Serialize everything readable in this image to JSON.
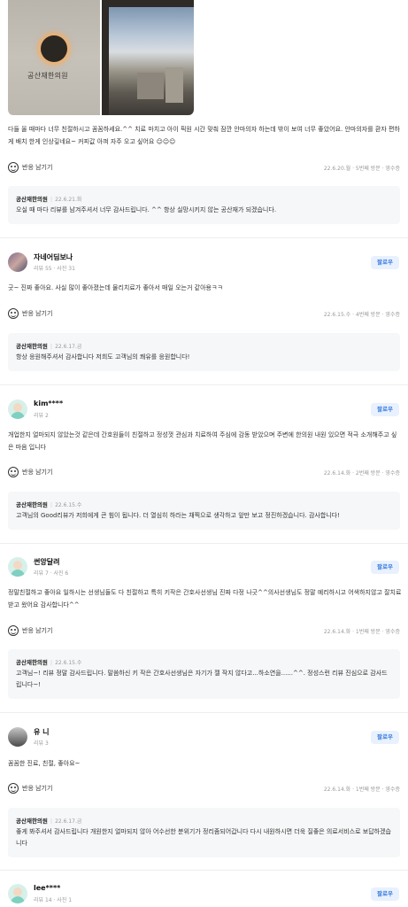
{
  "photos": {
    "sign_text": "공산재한의원"
  },
  "reviews": [
    {
      "body": "다들 올 때마다 너무 친절하시고 꼼꼼하세요.^^ 치료 마치고 아이 픽원 시간 맞춰 잠깐 안마의자 하는데 밖이 보여 너무 좋았어요. 안마의자를 환자 편하게 배치 한게 인상깊네요~ 커피값 아껴 자주 오고 싶어요 ☺☺☺",
      "react_label": "반응 남기기",
      "visit_info": "22.6.20.월 · 5번째 방문 · 영수증",
      "reply": {
        "name": "공산재한의원",
        "date": "22.6.21.화",
        "text": "오실 때 마다 리뷰를 남겨주셔서 너무 감사드립니다. ^^ 항상 실망시키지 않는 공산재가 되겠습니다."
      }
    },
    {
      "username": "자네어딤보나",
      "meta": "리뷰 55 · 사진 31",
      "follow_label": "팔로우",
      "body": "굿~ 진짜 좋아요. 사실 많이 좋아졌는데 물리치료가 좋아서 매일 오는거 같아용ㅋㅋ",
      "react_label": "반응 남기기",
      "visit_info": "22.6.15.수 · 4번째 방문 · 영수증",
      "reply": {
        "name": "공산재한의원",
        "date": "22.6.17.금",
        "text": "항상 응원해주셔서 감사합니다 저희도 고객님의 쾌유를 응원합니다!"
      }
    },
    {
      "username": "kim****",
      "meta": "리뷰 2",
      "follow_label": "팔로우",
      "body": "개업한지 얼마되지 않았는것 같은데 간호원들이 친절하고 정성껏 관심과 치료하여 주심에 감동 받았으며 주변에 한의원 내원 있으면 적극 소개해주고 싶은 마음 입니다",
      "react_label": "반응 남기기",
      "visit_info": "22.6.14.화 · 2번째 방문 · 영수증",
      "reply": {
        "name": "공산재한의원",
        "date": "22.6.15.수",
        "text": "고객님의 Good리뷰가 저희에게 큰 힘이 됩니다. 더 열심히 하라는 채찍으로 생각하고 앞만 보고 정진하겠습니다. 감사합니다!"
      }
    },
    {
      "username": "썬앙달려",
      "meta": "리뷰 7 · 사진 6",
      "follow_label": "팔로우",
      "body": "정말친절하고 좋아요 일하시는 선생님들도 다 친절하고 특히 키작은 간호사선생님 진짜 다정 나긋^^의사선생님도 정말 예리하시고 어색하지않고 잘치료받고 왔어요 감사합니다^^",
      "react_label": "반응 남기기",
      "visit_info": "22.6.14.화 · 1번째 방문 · 영수증",
      "reply": {
        "name": "공산재한의원",
        "date": "22.6.15.수",
        "text": "고객님~! 리뷰 정말 감사드립니다. 말씀하신 키 작은 간호사선생님은 자기가 젤 작지 않다고...하소연을......^^. 정성스런 리뷰 진심으로 감사드립니다~!"
      }
    },
    {
      "username": "유 니",
      "meta": "리뷰 3",
      "follow_label": "팔로우",
      "body": "꼼꼼한 진료, 친절, 좋아요~",
      "react_label": "반응 남기기",
      "visit_info": "22.6.14.화 · 1번째 방문 · 영수증",
      "reply": {
        "name": "공산재한의원",
        "date": "22.6.17.금",
        "text": "좋게 봐주셔서 감사드립니다 개원한지 얼마되지 않아 어수선한 분위기가 정리좀되어갑니다 다시 내원하시면 더욱 질좋은 의료서비스로 보답하겠습니다"
      }
    },
    {
      "username": "lee****",
      "meta": "리뷰 14 · 사진 1",
      "follow_label": "팔로우"
    }
  ],
  "colors": {
    "follow_bg": "#e8f1fd",
    "follow_text": "#3a7be0",
    "reply_bg": "#f6f7f8"
  }
}
